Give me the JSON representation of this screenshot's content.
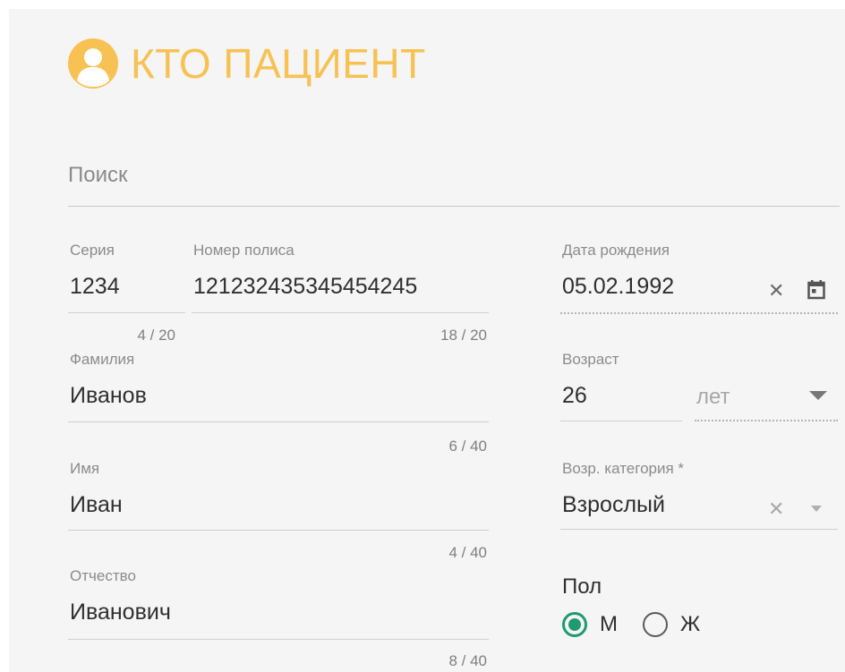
{
  "header": {
    "title": "КТО ПАЦИЕНТ"
  },
  "search": {
    "placeholder": "Поиск",
    "value": ""
  },
  "series": {
    "label": "Серия",
    "value": "1234",
    "counter": "4 / 20"
  },
  "policy": {
    "label": "Номер полиса",
    "value": "121232435345454245",
    "counter": "18 / 20"
  },
  "birth_date": {
    "label": "Дата рождения",
    "value": "05.02.1992",
    "clear_icon": "✕",
    "calendar_icon": "calendar-icon"
  },
  "last_name": {
    "label": "Фамилия",
    "value": "Иванов",
    "counter": "6 / 40"
  },
  "age": {
    "label": "Возраст",
    "value": "26",
    "unit": "лет"
  },
  "first_name": {
    "label": "Имя",
    "value": "Иван",
    "counter": "4 / 40"
  },
  "age_category": {
    "label": "Возр. категория *",
    "value": "Взрослый",
    "clear_icon": "✕"
  },
  "patronymic": {
    "label": "Отчество",
    "value": "Иванович",
    "counter": "8 / 40"
  },
  "gender": {
    "label": "Пол",
    "selected": "М",
    "options": [
      {
        "label": "М"
      },
      {
        "label": "Ж"
      }
    ]
  },
  "colors": {
    "accent": "#f7c153",
    "radio": "#1f9a73",
    "background": "#f5f5f5"
  }
}
